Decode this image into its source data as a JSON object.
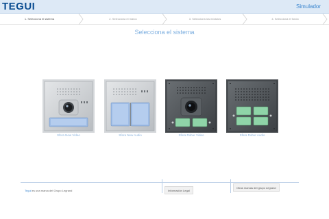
{
  "header": {
    "logo": "TEGUI",
    "app_title": "Simulador"
  },
  "steps": [
    {
      "label": "1. Selecciona el sistema",
      "active": true
    },
    {
      "label": "2. Selecciona el marco",
      "active": false
    },
    {
      "label": "3. Selecciona los módulos",
      "active": false
    },
    {
      "label": "4. Selecciona el fondo",
      "active": false
    }
  ],
  "main": {
    "title": "Selecciona el sistema",
    "products": [
      {
        "label": "Sfera New Video",
        "finish": "silver",
        "type": "video"
      },
      {
        "label": "Sfera New Audio",
        "finish": "silver",
        "type": "audio"
      },
      {
        "label": "Sfera Robur Video",
        "finish": "dark",
        "type": "video"
      },
      {
        "label": "Sfera Robur Audio",
        "finish": "dark",
        "type": "audio"
      }
    ]
  },
  "footer": {
    "brand_word": "Tegui",
    "brand_rest": " es una marca del Grupo Legrand",
    "legal_button": "Información Legal",
    "other_brands_button": "Otras marcas del grupo Legrand"
  }
}
